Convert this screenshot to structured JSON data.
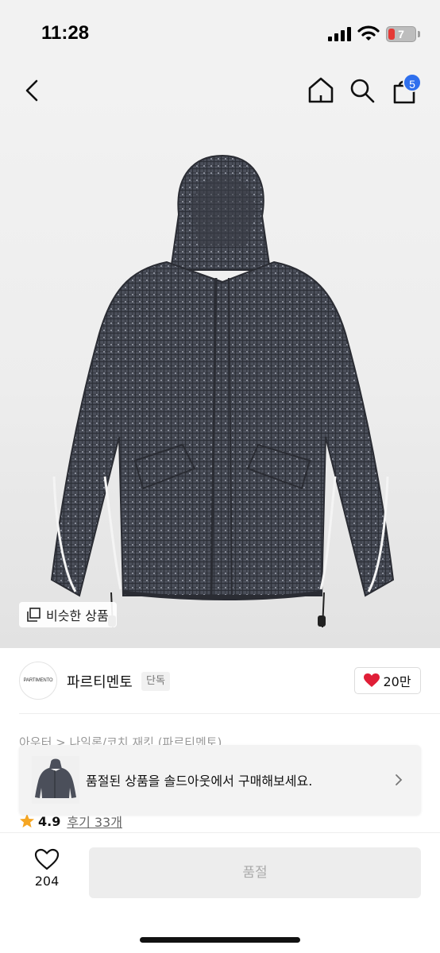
{
  "status_bar": {
    "time": "11:28",
    "battery": "7"
  },
  "nav": {
    "cart_count": "5",
    "icons": [
      "back-icon",
      "home-icon",
      "search-icon",
      "shopping-bag-icon"
    ]
  },
  "hero": {
    "similar_label": "비슷한 상품"
  },
  "brand": {
    "logo_text": "PARTIMENTO",
    "name": "파르티멘토",
    "tag": "단독",
    "likes": "20만"
  },
  "category": "아우터 > 나일론/코치 재킷 (파르티멘토)",
  "popup": {
    "message": "품절된 상품을 솔드아웃에서 구매해보세요."
  },
  "rating": {
    "score": "4.9",
    "reviews": "후기 33개"
  },
  "bottom": {
    "wish_count": "204",
    "buy_label": "품절"
  },
  "colors": {
    "accent_blue": "#2f6fed",
    "heart_red": "#e01e37",
    "star_orange": "#f5a623"
  }
}
